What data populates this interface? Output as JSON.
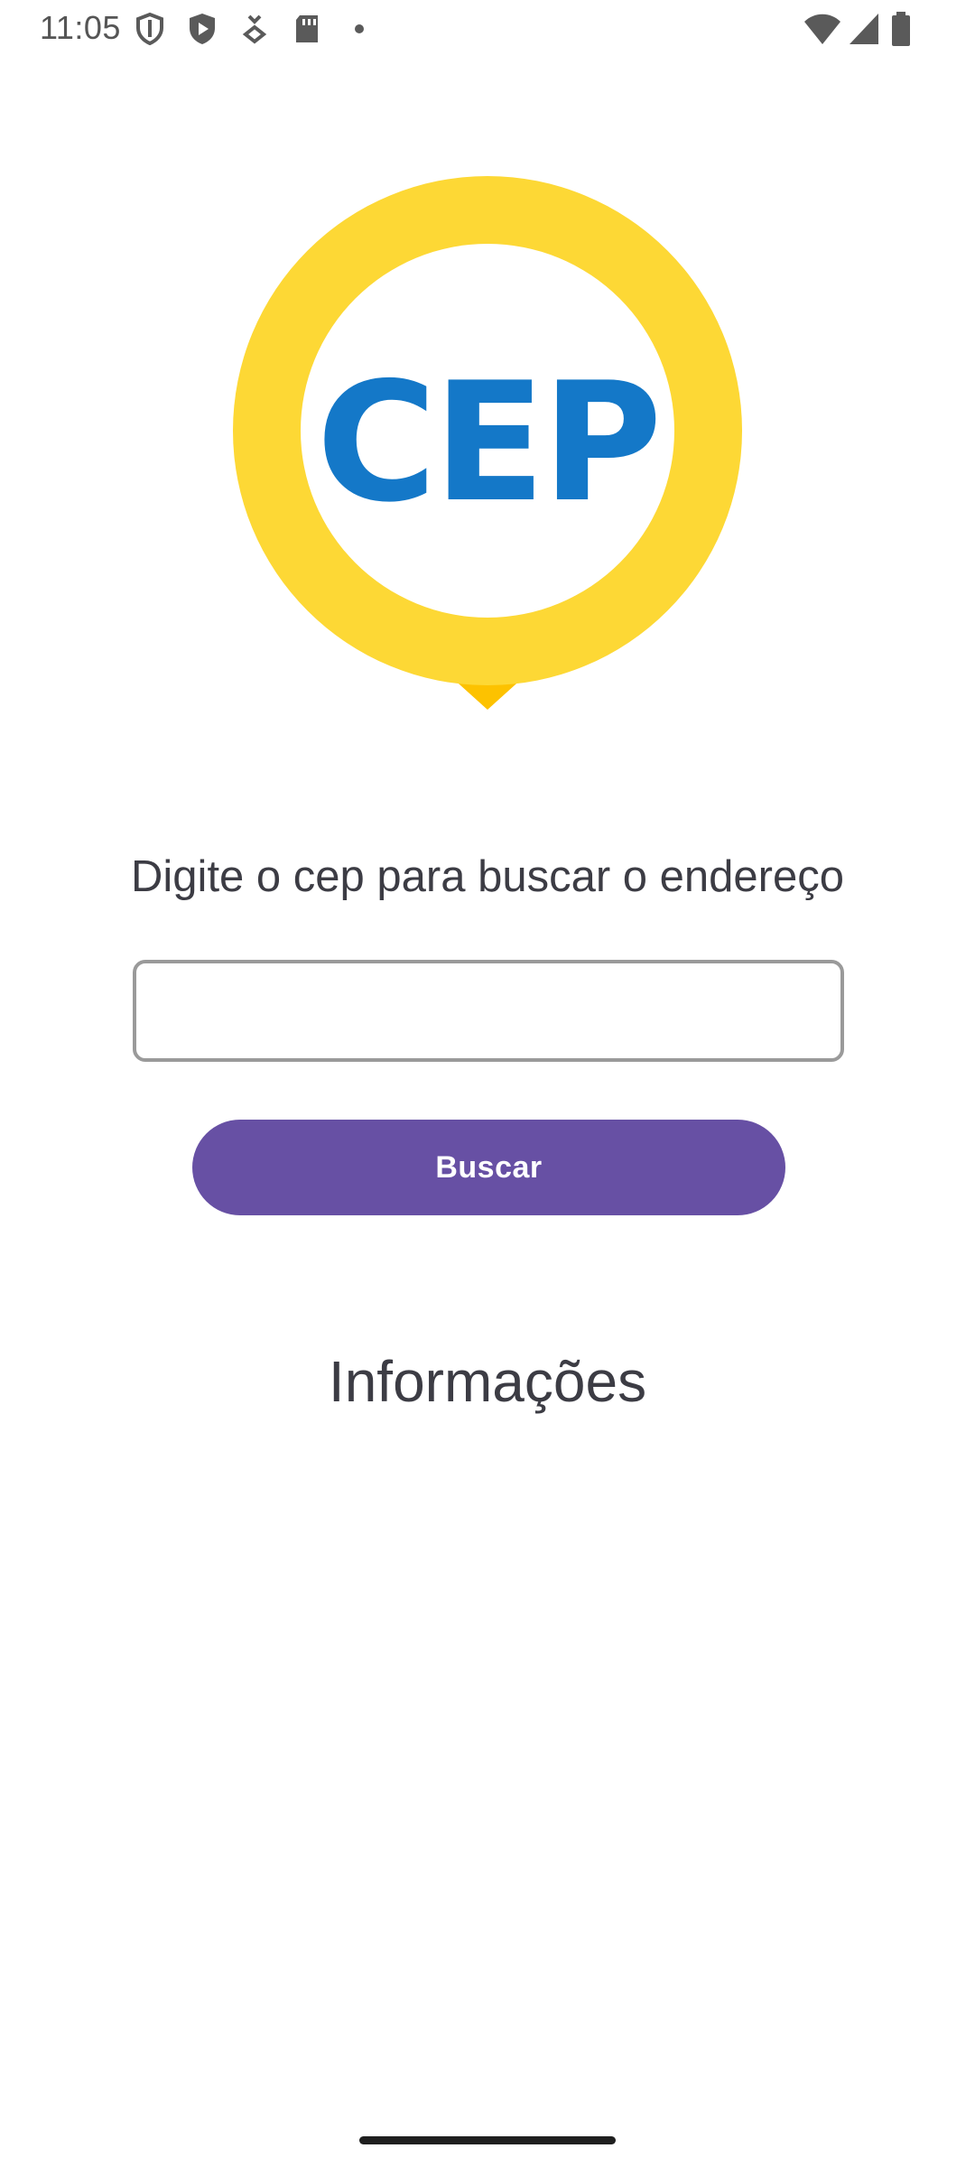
{
  "status_bar": {
    "time": "11:05",
    "left_icons": [
      "shield-outline-icon",
      "play-shield-icon",
      "download-arrow-icon",
      "sd-card-icon",
      "dot-icon"
    ],
    "right_icons": [
      "wifi-icon",
      "cellular-signal-icon",
      "battery-icon"
    ]
  },
  "logo": {
    "text": "CEP",
    "ring_color": "#FDD835",
    "text_color": "#1478C8"
  },
  "prompt": {
    "label": "Digite o cep para buscar o endereço"
  },
  "cep_input": {
    "value": "",
    "placeholder": ""
  },
  "search_button": {
    "label": "Buscar",
    "color": "#6750A4"
  },
  "info": {
    "heading": "Informações"
  }
}
